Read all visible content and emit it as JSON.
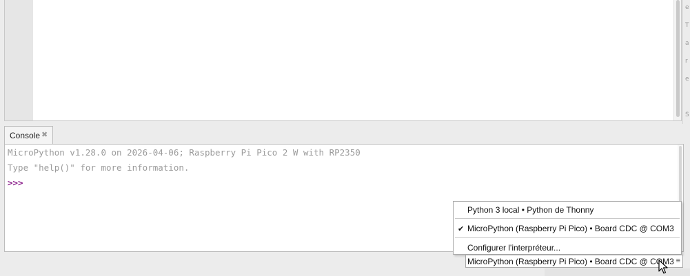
{
  "console_tab": {
    "label": "Console",
    "close_glyph": "✖"
  },
  "console": {
    "lines": [
      "MicroPython v1.28.0 on 2026-04-06; Raspberry Pi Pico 2 W with RP2350",
      "Type \"help()\" for more information."
    ],
    "prompt": ">>>"
  },
  "interpreter_menu": {
    "items": [
      {
        "label": "Python 3 local  •  Python de Thonny",
        "checked": false
      },
      {
        "label": "MicroPython (Raspberry Pi Pico)  •  Board CDC @ COM3",
        "checked": true,
        "check_glyph": "✔"
      },
      {
        "label": "Configurer l'interpréteur...",
        "checked": false
      }
    ]
  },
  "status_bar": {
    "interpreter": "MicroPython (Raspberry Pi Pico)  •  Board CDC @ COM3",
    "menu_glyph": "≡"
  },
  "right_strip_glyphs": [
    "e",
    "T",
    "a",
    "r",
    "e",
    "S"
  ],
  "colors": {
    "prompt": "#8b1f8b",
    "console_text": "#9b9b9b",
    "gutter": "#e6e6e6"
  }
}
